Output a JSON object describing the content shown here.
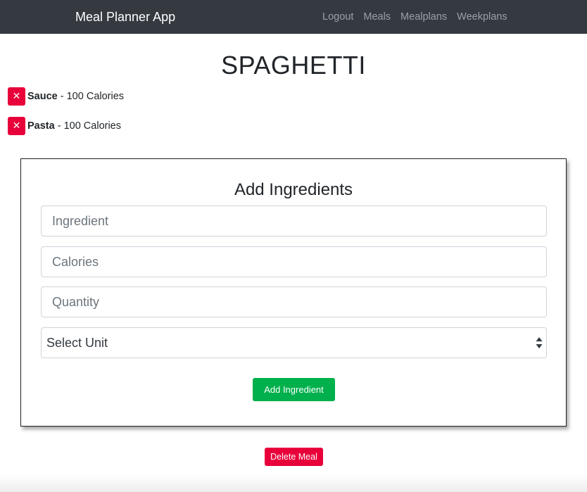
{
  "navbar": {
    "brand": "Meal Planner App",
    "links": [
      "Logout",
      "Meals",
      "Mealplans",
      "Weekplans"
    ]
  },
  "meal": {
    "title": "SPAGHETTI",
    "ingredients": [
      {
        "name": "Sauce",
        "detail": " - 100 Calories"
      },
      {
        "name": "Pasta",
        "detail": " - 100 Calories"
      }
    ],
    "remove_glyph": "✕"
  },
  "form": {
    "title": "Add Ingredients",
    "ingredient_placeholder": "Ingredient",
    "calories_placeholder": "Calories",
    "quantity_placeholder": "Quantity",
    "unit_selected": "Select Unit",
    "submit_label": "Add Ingredient"
  },
  "actions": {
    "delete_meal_label": "Delete Meal"
  },
  "colors": {
    "navbar_bg": "#343a40",
    "danger": "#e8003a",
    "success": "#00b04c"
  },
  "icons": {
    "remove": "close-icon",
    "select": "sort-arrows-icon"
  }
}
